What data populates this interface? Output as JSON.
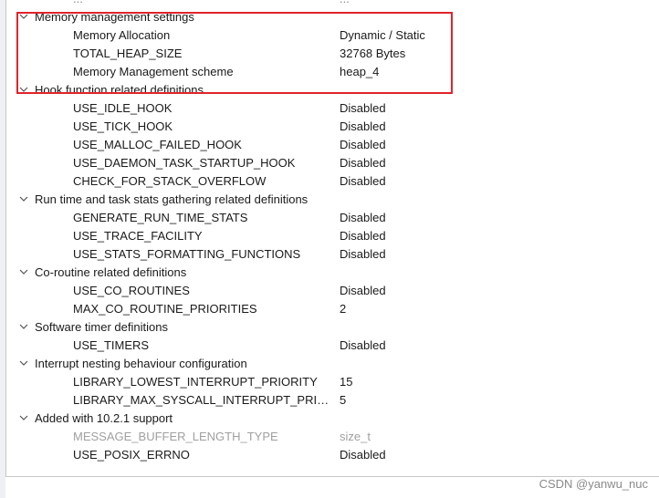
{
  "top_cut_row": {
    "name": "...",
    "value": "..."
  },
  "groups": [
    {
      "label": "Memory management settings",
      "params": [
        {
          "name": "Memory Allocation",
          "value": "Dynamic / Static"
        },
        {
          "name": "TOTAL_HEAP_SIZE",
          "value": "32768 Bytes"
        },
        {
          "name": "Memory Management scheme",
          "value": "heap_4"
        }
      ]
    },
    {
      "label": "Hook function related definitions",
      "params": [
        {
          "name": "USE_IDLE_HOOK",
          "value": "Disabled"
        },
        {
          "name": "USE_TICK_HOOK",
          "value": "Disabled"
        },
        {
          "name": "USE_MALLOC_FAILED_HOOK",
          "value": "Disabled"
        },
        {
          "name": "USE_DAEMON_TASK_STARTUP_HOOK",
          "value": "Disabled"
        },
        {
          "name": "CHECK_FOR_STACK_OVERFLOW",
          "value": "Disabled"
        }
      ]
    },
    {
      "label": "Run time and task stats gathering related definitions",
      "params": [
        {
          "name": "GENERATE_RUN_TIME_STATS",
          "value": "Disabled"
        },
        {
          "name": "USE_TRACE_FACILITY",
          "value": "Disabled"
        },
        {
          "name": "USE_STATS_FORMATTING_FUNCTIONS",
          "value": "Disabled"
        }
      ]
    },
    {
      "label": "Co-routine related definitions",
      "params": [
        {
          "name": "USE_CO_ROUTINES",
          "value": "Disabled"
        },
        {
          "name": "MAX_CO_ROUTINE_PRIORITIES",
          "value": "2"
        }
      ]
    },
    {
      "label": "Software timer definitions",
      "params": [
        {
          "name": "USE_TIMERS",
          "value": "Disabled"
        }
      ]
    },
    {
      "label": "Interrupt nesting behaviour configuration",
      "params": [
        {
          "name": "LIBRARY_LOWEST_INTERRUPT_PRIORITY",
          "value": "15"
        },
        {
          "name": "LIBRARY_MAX_SYSCALL_INTERRUPT_PRIO...",
          "value": "5"
        }
      ]
    },
    {
      "label": "Added with 10.2.1 support",
      "params": [
        {
          "name": "MESSAGE_BUFFER_LENGTH_TYPE",
          "value": "size_t",
          "disabled": true
        },
        {
          "name": "USE_POSIX_ERRNO",
          "value": "Disabled"
        }
      ]
    }
  ],
  "highlight_color": "#e0242c",
  "icons": {
    "group_toggle": "chevron-down-icon"
  },
  "watermark": "CSDN @yanwu_nuc"
}
